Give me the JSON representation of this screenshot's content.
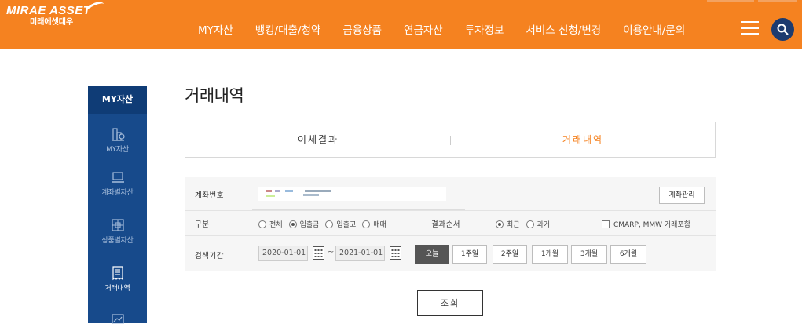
{
  "brand": {
    "name_en": "MIRAE ASSET",
    "name_ko": "미래에셋대우",
    "primary": "#f58220",
    "navy": "#174a8b"
  },
  "nav": {
    "items": [
      "MY자산",
      "뱅킹/대출/청약",
      "금융상품",
      "연금자산",
      "투자정보",
      "서비스 신청/변경",
      "이용안내/문의"
    ],
    "menu_icon": "hamburger-icon",
    "search_icon": "search-icon"
  },
  "sidebar": {
    "title": "MY자산",
    "items": [
      {
        "label": "MY자산",
        "icon": "building-chart-icon"
      },
      {
        "label": "계좌별자산",
        "icon": "laptop-icon"
      },
      {
        "label": "상품별자산",
        "icon": "grid-box-icon"
      },
      {
        "label": "거래내역",
        "icon": "receipt-icon"
      }
    ]
  },
  "page": {
    "title": "거래내역"
  },
  "tabs": {
    "left": "이체결과",
    "right": "거래내역",
    "active": "right"
  },
  "form": {
    "account_label": "계좌번호",
    "account_manage": "계좌관리",
    "type_label": "구분",
    "type_options": [
      "전체",
      "입출금",
      "입출고",
      "매매"
    ],
    "type_selected": "입출금",
    "sort_label": "결과순서",
    "sort_options": [
      "최근",
      "과거"
    ],
    "sort_selected": "최근",
    "include_label": "CMARP, MMW 거래포함",
    "period_label": "검색기간",
    "date_from": "2020-01-01",
    "date_to": "2021-01-01",
    "tilde": "~",
    "period_buttons": [
      "오늘",
      "1주일",
      "2주일",
      "1개월",
      "3개월",
      "6개월"
    ],
    "period_active": "오늘"
  },
  "submit": {
    "label": "조회"
  }
}
